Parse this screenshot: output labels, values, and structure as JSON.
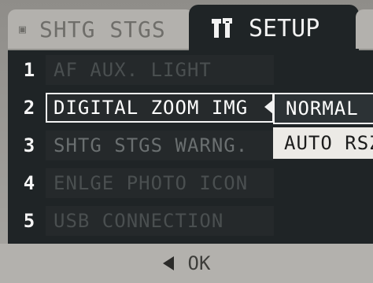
{
  "tabs": {
    "shooting": {
      "label": "SHTG STGS",
      "icon": "camera-icon"
    },
    "setup": {
      "label": "SETUP",
      "icon": "tools-icon"
    }
  },
  "menu": {
    "items": [
      {
        "number": "1",
        "label": "AF AUX. LIGHT"
      },
      {
        "number": "2",
        "label": "DIGITAL ZOOM IMG"
      },
      {
        "number": "3",
        "label": "SHTG STGS WARNG."
      },
      {
        "number": "4",
        "label": "ENLGE PHOTO ICON"
      },
      {
        "number": "5",
        "label": "USB CONNECTION"
      }
    ],
    "selected_index": 1
  },
  "submenu": {
    "options": [
      "NORMAL",
      "AUTO RSZ"
    ],
    "selected": "NORMAL"
  },
  "footer": {
    "back_icon": "left-triangle-icon",
    "ok_label": "OK"
  },
  "colors": {
    "panel": "#1f2426",
    "frame": "#b3b1ad",
    "highlight": "#f2f2f2"
  }
}
